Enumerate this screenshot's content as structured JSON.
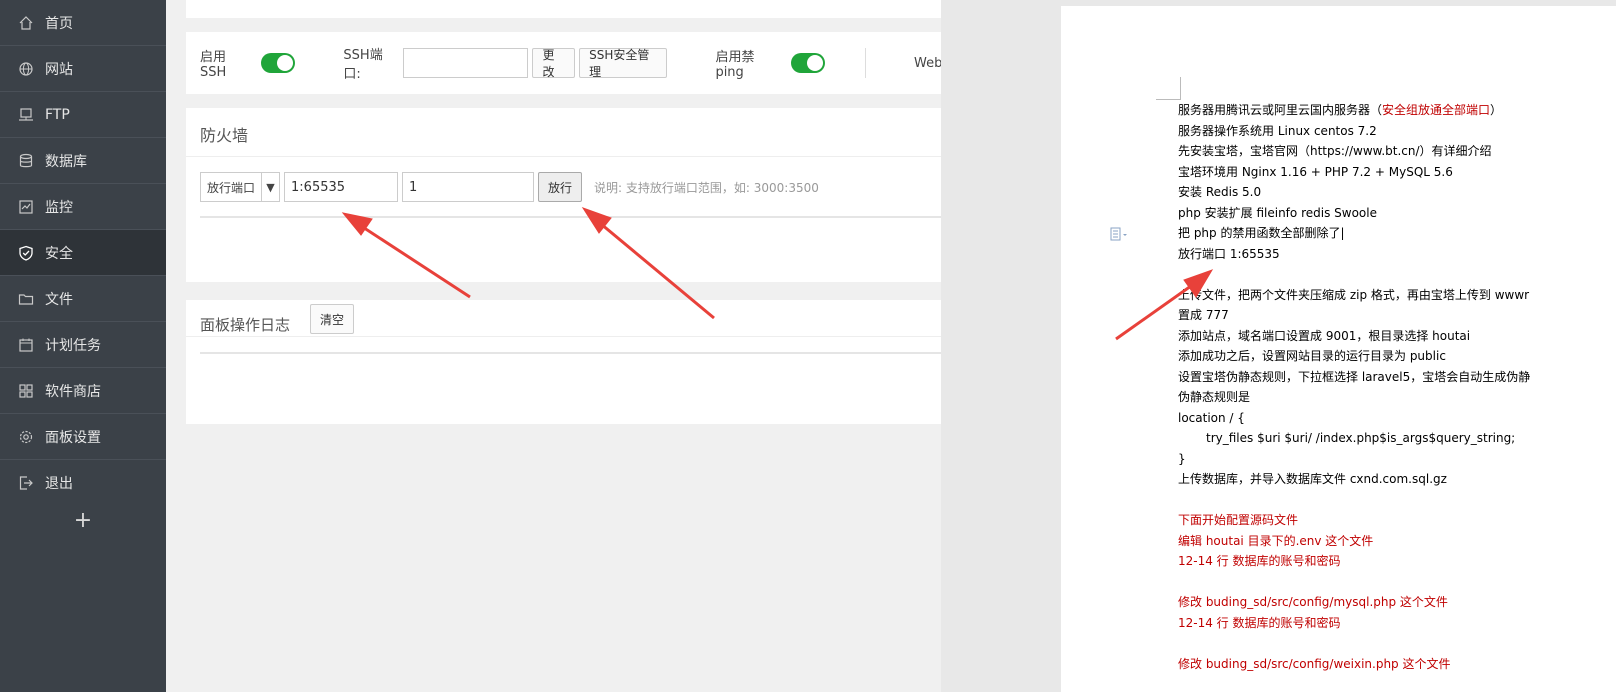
{
  "sidebar": {
    "items": [
      {
        "label": "首页",
        "icon": "home-icon"
      },
      {
        "label": "网站",
        "icon": "globe-icon"
      },
      {
        "label": "FTP",
        "icon": "ftp-icon"
      },
      {
        "label": "数据库",
        "icon": "database-icon"
      },
      {
        "label": "监控",
        "icon": "monitor-icon"
      },
      {
        "label": "安全",
        "icon": "shield-icon"
      },
      {
        "label": "文件",
        "icon": "folder-icon"
      },
      {
        "label": "计划任务",
        "icon": "calendar-icon"
      },
      {
        "label": "软件商店",
        "icon": "apps-icon"
      },
      {
        "label": "面板设置",
        "icon": "gear-icon"
      },
      {
        "label": "退出",
        "icon": "logout-icon"
      }
    ],
    "active_index": 5,
    "add_symbol": "+"
  },
  "ssh": {
    "enable_ssh_label": "启用SSH",
    "enable_ssh_on": true,
    "port_label": "SSH端口:",
    "port_value": "",
    "change_btn": "更改",
    "ssh_security_btn": "SSH安全管理",
    "ban_ping_label": "启用禁ping",
    "ban_ping_on": true,
    "web_label": "Webl"
  },
  "firewall": {
    "title": "防火墙",
    "select_value": "放行端口",
    "port_value": "1:65535",
    "remark_value": "1",
    "submit_btn": "放行",
    "hint": "说明: 支持放行端口范围，如: 3000:3500"
  },
  "log": {
    "title": "面板操作日志",
    "clear_btn": "清空"
  },
  "document": {
    "lines": [
      {
        "segments": [
          {
            "t": "服务器用腾讯云或阿里云国内服务器（"
          },
          {
            "t": "安全组放通全部端口",
            "red": true
          },
          {
            "t": "）"
          }
        ]
      },
      {
        "segments": [
          {
            "t": "服务器操作系统用 Linux centos 7.2"
          }
        ]
      },
      {
        "segments": [
          {
            "t": "先安装宝塔，宝塔官网（https://www.bt.cn/）有详细介绍"
          }
        ]
      },
      {
        "segments": [
          {
            "t": "宝塔环境用 Nginx 1.16 + PHP 7.2 + MySQL 5.6"
          }
        ]
      },
      {
        "segments": [
          {
            "t": "安装 Redis 5.0"
          }
        ]
      },
      {
        "segments": [
          {
            "t": "php 安装扩展 fileinfo    redis    Swoole"
          }
        ]
      },
      {
        "segments": [
          {
            "t": "把 php 的禁用函数全部删除了|"
          }
        ]
      },
      {
        "segments": [
          {
            "t": "放行端口  1:65535"
          }
        ]
      },
      {
        "segments": [
          {
            "t": ""
          }
        ]
      },
      {
        "segments": [
          {
            "t": "上传文件，把两个文件夹压缩成 zip 格式，再由宝塔上传到 wwwr"
          }
        ]
      },
      {
        "segments": [
          {
            "t": "置成 777"
          }
        ]
      },
      {
        "segments": [
          {
            "t": "添加站点，域名端口设置成 9001，根目录选择 houtai"
          }
        ]
      },
      {
        "segments": [
          {
            "t": "添加成功之后，设置网站目录的运行目录为 public"
          }
        ]
      },
      {
        "segments": [
          {
            "t": "设置宝塔伪静态规则，下拉框选择 laravel5，宝塔会自动生成伪静"
          }
        ]
      },
      {
        "segments": [
          {
            "t": "伪静态规则是"
          }
        ]
      },
      {
        "segments": [
          {
            "t": "location / {"
          }
        ]
      },
      {
        "segments": [
          {
            "t": "try_files $uri $uri/ /index.php$is_args$query_string;"
          }
        ],
        "indent": true
      },
      {
        "segments": [
          {
            "t": "}"
          }
        ]
      },
      {
        "segments": [
          {
            "t": "上传数据库，并导入数据库文件 cxnd.com.sql.gz"
          }
        ]
      },
      {
        "segments": [
          {
            "t": ""
          }
        ]
      },
      {
        "segments": [
          {
            "t": "下面开始配置源码文件",
            "red": true
          }
        ]
      },
      {
        "segments": [
          {
            "t": "编辑 houtai 目录下的.env 这个文件",
            "red": true
          }
        ]
      },
      {
        "segments": [
          {
            "t": "12-14 行  数据库的账号和密码",
            "red": true
          }
        ]
      },
      {
        "segments": [
          {
            "t": ""
          }
        ]
      },
      {
        "segments": [
          {
            "t": "修改 buding_sd/src/config/mysql.php 这个文件",
            "red": true
          }
        ]
      },
      {
        "segments": [
          {
            "t": "12-14 行  数据库的账号和密码",
            "red": true
          }
        ]
      },
      {
        "segments": [
          {
            "t": ""
          }
        ]
      },
      {
        "segments": [
          {
            "t": "修改 buding_sd/src/config/weixin.php 这个文件",
            "red": true
          }
        ]
      }
    ]
  },
  "colors": {
    "sidebar_bg": "#3b4148",
    "sidebar_active": "#2e3338",
    "toggle_on": "#20a53a",
    "arrow_red": "#e8413a",
    "doc_red": "#c00000"
  }
}
